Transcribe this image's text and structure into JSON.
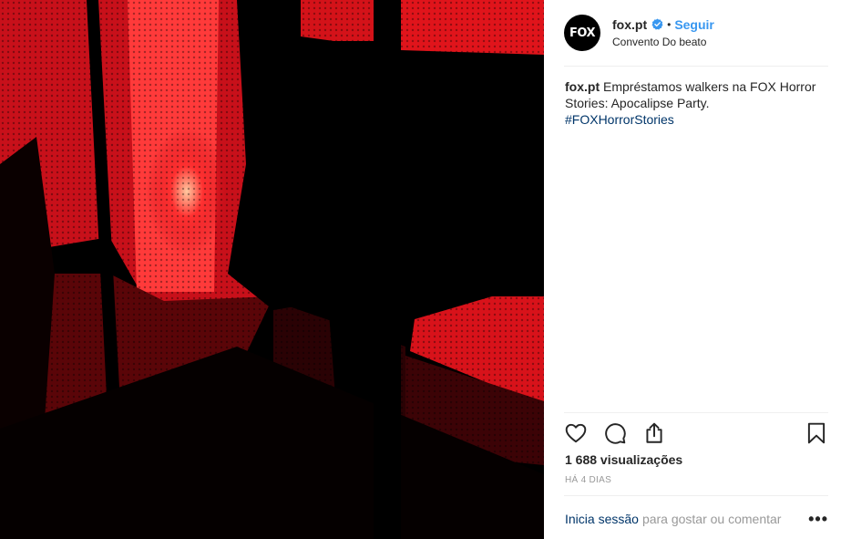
{
  "post": {
    "account": {
      "avatar_text": "FOX",
      "username": "fox.pt",
      "verified": true,
      "follow_separator": "•",
      "follow_label": "Seguir",
      "location": "Convento Do beato"
    },
    "caption": {
      "username": "fox.pt",
      "text": "Empréstamos walkers na FOX Horror Stories: Apocalipse Party.",
      "hashtag": "#FOXHorrorStories"
    },
    "views": "1 688 visualizações",
    "time_ago": "HÁ 4 DIAS",
    "login": {
      "link_label": "Inicia sessão",
      "rest_text": "para gostar ou comentar",
      "more_label": "•••"
    }
  },
  "icons": {
    "like": "heart-icon",
    "comment": "comment-icon",
    "share": "share-icon",
    "save": "bookmark-icon",
    "verified": "verified-badge-icon"
  },
  "colors": {
    "accent": "#3897f0",
    "link": "#003569",
    "muted": "#999999",
    "media_red": "#e0141b"
  }
}
